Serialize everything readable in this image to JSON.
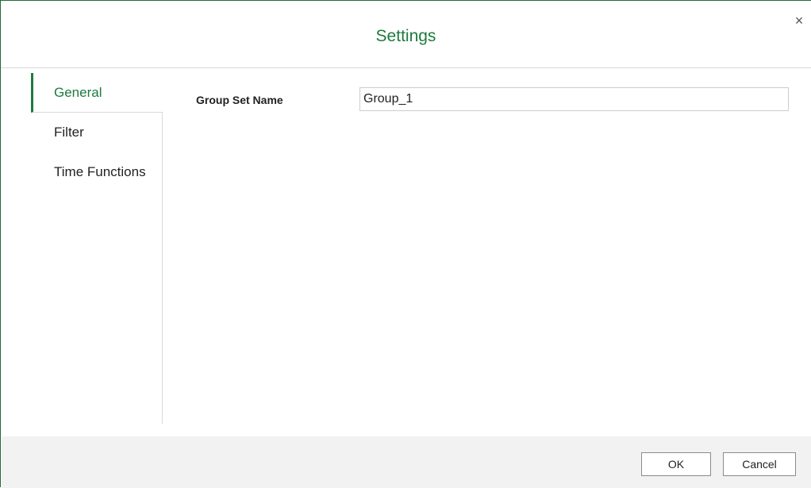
{
  "dialog": {
    "title": "Settings",
    "close_glyph": "×",
    "close_icon": "close-icon",
    "accent_color": "#1e7a3e"
  },
  "sidebar": {
    "items": [
      {
        "label": "General",
        "active": true
      },
      {
        "label": "Filter",
        "active": false
      },
      {
        "label": "Time Functions",
        "active": false
      }
    ]
  },
  "general": {
    "group_set_name_label": "Group Set Name",
    "group_set_name_value": "Group_1"
  },
  "footer": {
    "ok_label": "OK",
    "cancel_label": "Cancel"
  }
}
